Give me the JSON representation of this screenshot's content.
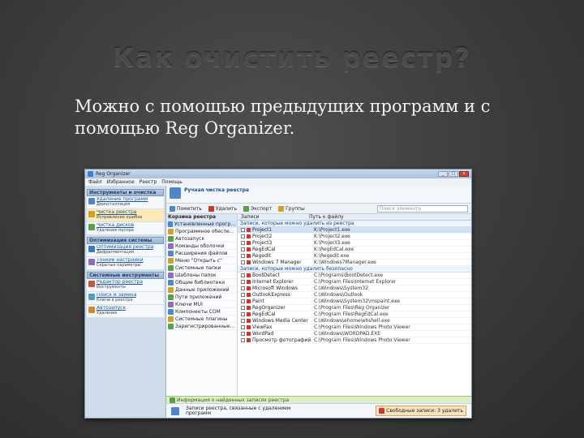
{
  "slide": {
    "title": "Как очистить реестр?",
    "body_line1": "Можно с помощью предыдущих программ и с",
    "body_line2": "помощью Reg Organizer."
  },
  "window": {
    "title": "Reg Organizer",
    "menu": [
      "Файл",
      "Избранное",
      "Реестр",
      "Помощь"
    ],
    "buttons": [
      "_",
      "□",
      "x"
    ]
  },
  "sidebar": {
    "sections": [
      {
        "title": "Инструменты и очистка",
        "items": [
          {
            "title": "Удаление программ",
            "desc": "Деинсталляция",
            "color": "#4f86c6"
          },
          {
            "title": "Чистка реестра",
            "desc": "Исправление ошибок",
            "color": "#d0a02a",
            "active": true
          },
          {
            "title": "Чистка дисков",
            "desc": "Удаление мусора",
            "color": "#5aa04a"
          }
        ]
      },
      {
        "title": "Оптимизация системы",
        "items": [
          {
            "title": "Оптимизация реестра",
            "desc": "Дефрагментация",
            "color": "#3d78c4"
          },
          {
            "title": "Тонкие настройки",
            "desc": "Скрытые параметры",
            "color": "#8a6fc0"
          }
        ]
      },
      {
        "title": "Системные инструменты",
        "items": [
          {
            "title": "Редактор реестра",
            "desc": "Инструменты",
            "color": "#c4573d"
          },
          {
            "title": "Поиск и замена",
            "desc": "Ключи в реестре",
            "color": "#4f9ec6"
          },
          {
            "title": "Автозапуск",
            "desc": "Удаление",
            "color": "#d08a2a"
          }
        ]
      }
    ]
  },
  "main": {
    "title": "Ручная чистка реестра",
    "toolbar": {
      "mark": "Пометить",
      "delete": "Удалить",
      "export": "Экспорт",
      "groups": "Группы",
      "search_placeholder": "Поиск элемента"
    },
    "categories_head": "Корзина реестра",
    "categories": [
      "Установленные прогр...",
      "Программное обеспе...",
      "Автозапуск",
      "Команды оболочки",
      "Расширения файлов",
      "Меню \"Открыть с\"",
      "Системные папки",
      "Шаблоны папок",
      "Общие библиотеки",
      "Данные приложений",
      "Пути приложений",
      "Ключи MUI",
      "Компоненты COM",
      "Системные плагины",
      "Зарегистрированные..."
    ],
    "grid_head": {
      "name": "Записи",
      "path": "Путь к файлу"
    },
    "groups": [
      "Записи, которые можно удалить из реестра",
      "Записи, которые можно удалить безопасно"
    ],
    "rows_a": [
      {
        "name": "Project1",
        "path": "K:\\Project1.exe"
      },
      {
        "name": "Project2",
        "path": "K:\\Project2.exe"
      },
      {
        "name": "Project3",
        "path": "K:\\Project3.exe"
      },
      {
        "name": "RegEdCal",
        "path": "K:\\RegEdCal.exe"
      },
      {
        "name": "Regedit",
        "path": "K:\\Regedit.exe"
      },
      {
        "name": "Windows 7 Manager",
        "path": "K:\\Windows7Manager.exe"
      }
    ],
    "rows_b": [
      {
        "name": "BootDetect",
        "path": "C:\\Programs\\BootDetect.exe"
      },
      {
        "name": "Internet Explorer",
        "path": "C:\\Program Files\\Internet Explorer"
      },
      {
        "name": "Microsoft Windows",
        "path": "C:\\Windows\\System32"
      },
      {
        "name": "OutlookExpress",
        "path": "C:\\Windows\\Outlook"
      },
      {
        "name": "Paint",
        "path": "C:\\Windows\\System32\\mspaint.exe"
      },
      {
        "name": "RegOrganizer",
        "path": "C:\\Program Files\\Reg Organizer"
      },
      {
        "name": "RegEdCal",
        "path": "C:\\Program Files\\RegEdCal.exe"
      },
      {
        "name": "Windows Media Center",
        "path": "C:\\Windows\\ehome\\ehshell.exe"
      },
      {
        "name": "ViewFax",
        "path": "C:\\Program Files\\Windows Photo Viewer"
      },
      {
        "name": "WordPad",
        "path": "C:\\Windows\\WORDPAD.EXE"
      },
      {
        "name": "Просмотр фотографий",
        "path": "C:\\Program Files\\Windows Photo Viewer"
      }
    ],
    "status_bar": "Информация о найденных записях реестра",
    "footer_text": "Записи реестра, связанные с удалением программ",
    "footer_badge": "Свободные записи: 3 удалить"
  }
}
